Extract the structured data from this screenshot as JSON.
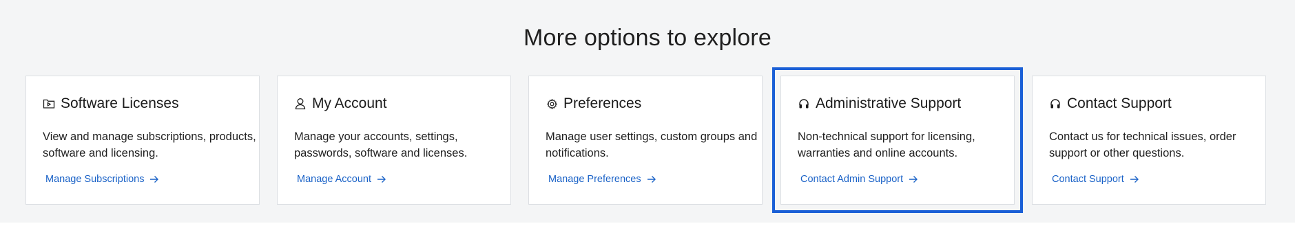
{
  "section": {
    "heading": "More options to explore"
  },
  "cards": [
    {
      "title": "Software Licenses",
      "icon": "play-folder-icon",
      "description": "View and manage subscriptions, products, software and licensing.",
      "link": "Manage Subscriptions"
    },
    {
      "title": "My Account",
      "icon": "user-icon",
      "description": "Manage your accounts, settings, passwords, software and licenses.",
      "link": "Manage Account"
    },
    {
      "title": "Preferences",
      "icon": "gear-icon",
      "description": "Manage user settings, custom groups and notifications.",
      "link": "Manage Preferences"
    },
    {
      "title": "Administrative Support",
      "icon": "headset-icon",
      "description": "Non-technical support for licensing, warranties and online accounts.",
      "link": "Contact Admin Support",
      "focused": true
    },
    {
      "title": "Contact Support",
      "icon": "headset-icon",
      "description": "Contact us for technical issues, order support or other questions.",
      "link": "Contact Support"
    }
  ],
  "colors": {
    "link": "#1a62c7",
    "focus_outline": "#1a5fd6",
    "section_bg": "#f4f5f6"
  }
}
